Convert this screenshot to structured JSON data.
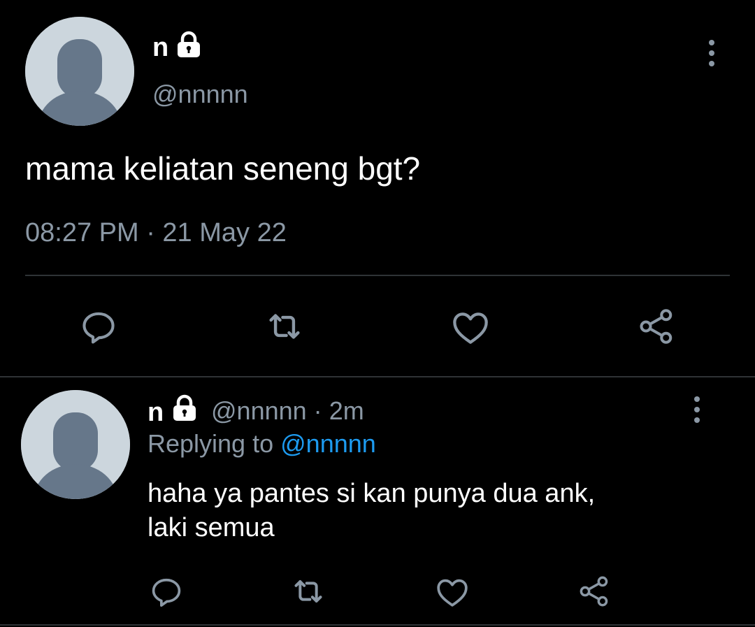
{
  "colors": {
    "background": "#000000",
    "text": "#ffffff",
    "muted": "#8b98a5",
    "accent": "#1d9bf0",
    "divider": "#2f3336",
    "avatar_bg": "#ccd6dd",
    "avatar_fg": "#66778a"
  },
  "main_tweet": {
    "author_name": "n",
    "author_handle": "@nnnnn",
    "text": "mama keliatan seneng bgt?",
    "timestamp": "08:27 PM · 21 May 22",
    "icons": {
      "lock": "lock-icon",
      "menu": "more-vertical-icon",
      "reply": "reply-icon",
      "retweet": "retweet-icon",
      "like": "heart-icon",
      "share": "share-icon"
    }
  },
  "reply_tweet": {
    "author_name": "n",
    "author_handle": "@nnnnn",
    "separator": "·",
    "time_ago": "2m",
    "replying_prefix": "Replying to",
    "replying_handle": "@nnnnn",
    "text_line1": "haha ya pantes si kan punya dua ank,",
    "text_line2": "laki semua",
    "icons": {
      "lock": "lock-icon",
      "menu": "more-vertical-icon",
      "reply": "reply-icon",
      "retweet": "retweet-icon",
      "like": "heart-icon",
      "share": "share-icon"
    }
  }
}
